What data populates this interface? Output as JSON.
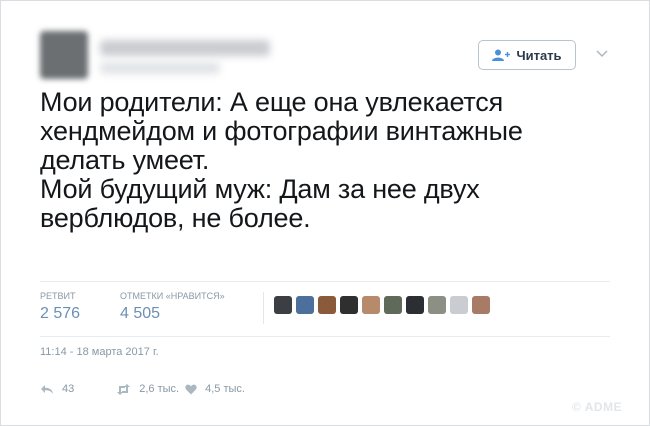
{
  "follow_button": {
    "label": "Читать",
    "icon": "add-user-icon"
  },
  "tweet": {
    "lines": [
      "Мои родители: А еще она увлекается",
      "хендмейдом и фотографии винтажные",
      "делать умеет.",
      "Мой будущий муж: Дам за нее двух",
      "верблюдов, не более."
    ]
  },
  "stats": {
    "retweets_label": "РЕТВИТ",
    "retweets_value": "2 576",
    "likes_label": "ОТМЕТКИ «НРАВИТСЯ»",
    "likes_value": "4 505"
  },
  "likers": [
    "#3b3f44",
    "#4d6f9c",
    "#8a5a3a",
    "#2f2f2f",
    "#b68a6a",
    "#5f6a5a",
    "#2b2e33",
    "#8c8f84",
    "#c9cdd2",
    "#a77b66"
  ],
  "timestamp": "11:14 - 18 марта 2017 г.",
  "actions": {
    "reply_count": "43",
    "retweet_count": "2,6 тыс.",
    "like_count": "4,5 тыс."
  },
  "watermark": "© ADME",
  "colors": {
    "link": "#6b8fb5",
    "muted": "#8899a6",
    "border": "#d9dde1"
  }
}
